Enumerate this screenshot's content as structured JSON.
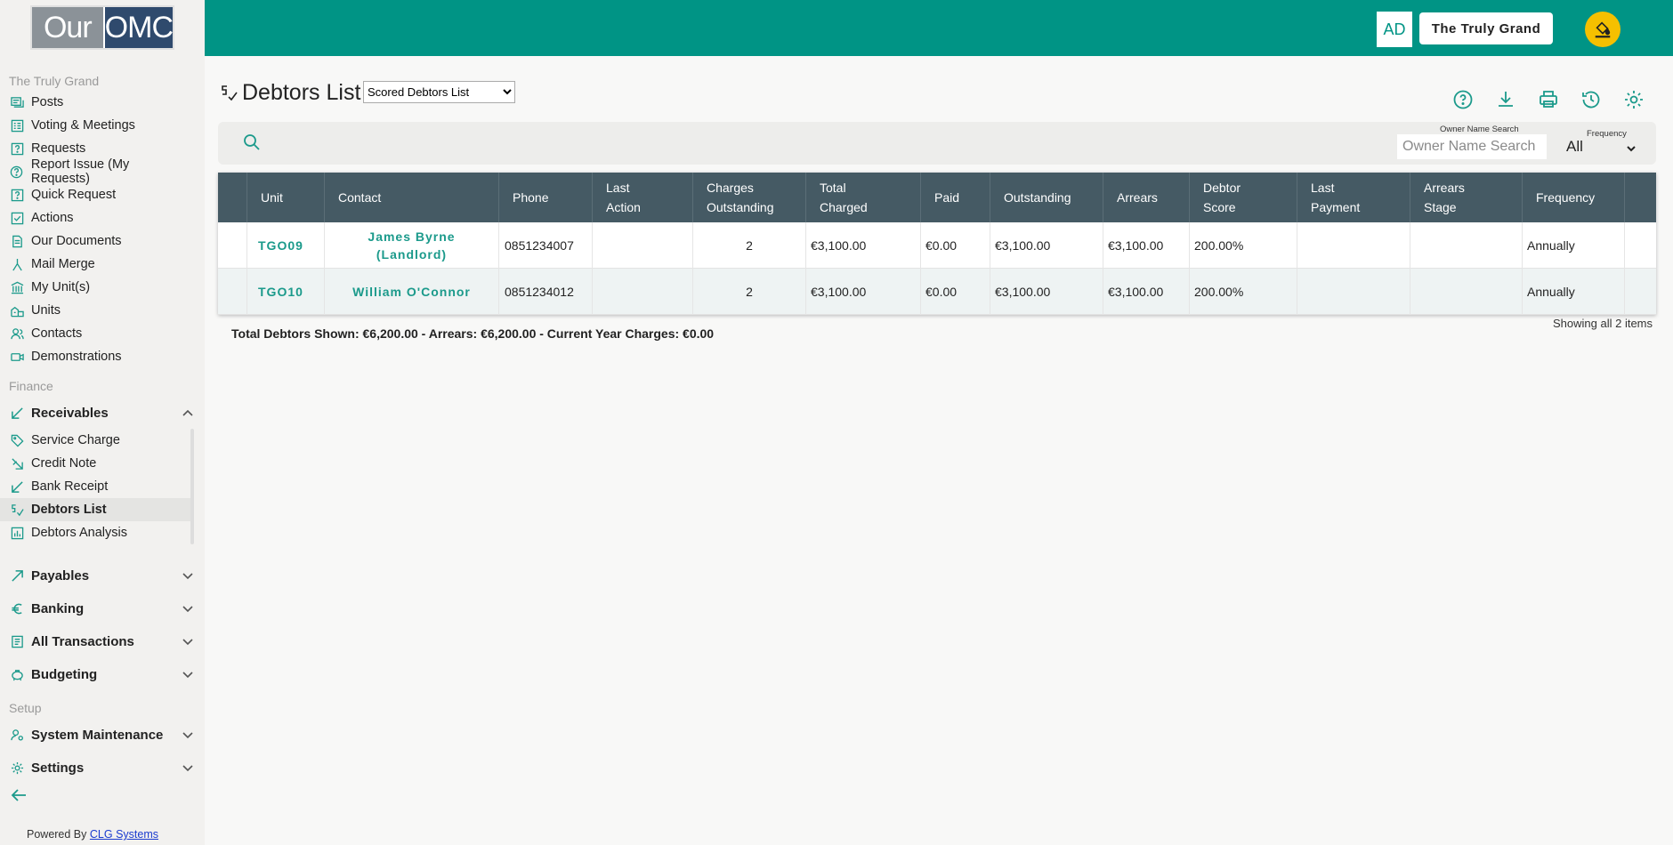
{
  "app": {
    "logo_left": "Our",
    "logo_right": "OMC",
    "avatar_initials": "AD",
    "building": "The Truly Grand"
  },
  "sidebar": {
    "section1": "The Truly Grand",
    "items1": [
      {
        "label": "Posts",
        "icon": "posts-icon"
      },
      {
        "label": "Voting & Meetings",
        "icon": "voting-icon"
      },
      {
        "label": "Requests",
        "icon": "requests-icon"
      },
      {
        "label": "Report Issue (My Requests)",
        "icon": "report-issue-icon"
      },
      {
        "label": "Quick Request",
        "icon": "quick-request-icon"
      },
      {
        "label": "Actions",
        "icon": "actions-icon"
      },
      {
        "label": "Our Documents",
        "icon": "documents-icon"
      },
      {
        "label": "Mail Merge",
        "icon": "mail-merge-icon"
      },
      {
        "label": "My Unit(s)",
        "icon": "my-units-icon"
      },
      {
        "label": "Units",
        "icon": "units-icon"
      },
      {
        "label": "Contacts",
        "icon": "contacts-icon"
      },
      {
        "label": "Demonstrations",
        "icon": "demonstrations-icon"
      }
    ],
    "section2": "Finance",
    "receivables": "Receivables",
    "receivables_items": [
      {
        "label": "Service Charge",
        "icon": "tag-icon"
      },
      {
        "label": "Credit Note",
        "icon": "credit-note-icon"
      },
      {
        "label": "Bank Receipt",
        "icon": "receipt-arrow-icon"
      },
      {
        "label": "Debtors List",
        "icon": "debtors-icon"
      },
      {
        "label": "Debtors Analysis",
        "icon": "analysis-icon"
      }
    ],
    "payables": "Payables",
    "banking": "Banking",
    "all_transactions": "All Transactions",
    "budgeting": "Budgeting",
    "section3": "Setup",
    "system_maintenance": "System Maintenance",
    "settings": "Settings",
    "powered_by": "Powered By",
    "powered_link": "CLG Systems"
  },
  "page": {
    "title": "Debtors List",
    "list_select": "Scored Debtors List",
    "owner_label": "Owner Name Search",
    "owner_placeholder": "Owner Name Search",
    "frequency_label": "Frequency",
    "frequency_value": "All"
  },
  "table": {
    "headers": [
      "Unit",
      "Contact",
      "Phone",
      "Last Action",
      "Charges Outstanding",
      "Total Charged",
      "Paid",
      "Outstanding",
      "Arrears",
      "Debtor Score",
      "Last Payment",
      "Arrears Stage",
      "Frequency"
    ],
    "rows": [
      {
        "unit": "TGO09",
        "contact": "James Byrne (Landlord)",
        "phone": "0851234007",
        "last_action": "",
        "charges": "2",
        "total": "€3,100.00",
        "paid": "€0.00",
        "outstanding": "€3,100.00",
        "arrears": "€3,100.00",
        "score": "200.00%",
        "last_payment": "",
        "stage": "",
        "frequency": "Annually"
      },
      {
        "unit": "TGO10",
        "contact": "William O'Connor",
        "phone": "0851234012",
        "last_action": "",
        "charges": "2",
        "total": "€3,100.00",
        "paid": "€0.00",
        "outstanding": "€3,100.00",
        "arrears": "€3,100.00",
        "score": "200.00%",
        "last_payment": "",
        "stage": "",
        "frequency": "Annually"
      }
    ]
  },
  "summary": {
    "totals": "Total Debtors Shown: €6,200.00 - Arrears: €6,200.00 - Current Year Charges: €0.00",
    "showing": "Showing all 2 items"
  },
  "colors": {
    "brand": "#009485",
    "accent_icon": "#1b9a8b",
    "table_header": "#455a64",
    "theme_button": "#f5c000"
  }
}
